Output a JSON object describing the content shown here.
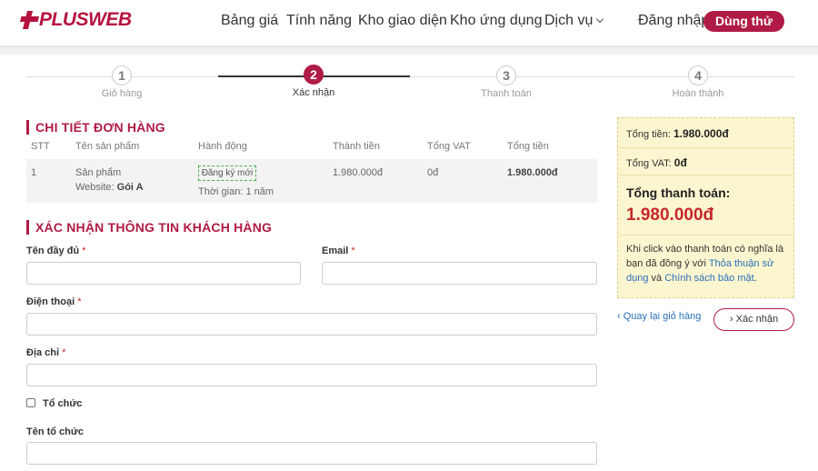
{
  "brand": {
    "logo_plus": "PLUS",
    "logo_web": "WEB",
    "color": "#b01b45"
  },
  "nav": {
    "pricing": "Bảng giá",
    "features": "Tính năng",
    "themes": "Kho giao diện",
    "apps": "Kho ứng dụng",
    "services": "Dịch vụ",
    "login": "Đăng nhập",
    "trial": "Dùng thử"
  },
  "steps": [
    {
      "num": "1",
      "label": "Giỏ hàng"
    },
    {
      "num": "2",
      "label": "Xác nhận"
    },
    {
      "num": "3",
      "label": "Thanh toán"
    },
    {
      "num": "4",
      "label": "Hoàn thành"
    }
  ],
  "order": {
    "title": "CHI TIẾT ĐƠN HÀNG",
    "headers": {
      "stt": "STT",
      "product": "Tên sản phẩm",
      "action": "Hành động",
      "amount": "Thành tiền",
      "vat": "Tổng VAT",
      "total": "Tổng tiền"
    },
    "row": {
      "stt": "1",
      "product": "Sản phẩm",
      "website_label": "Website: ",
      "website_value": "Gói A",
      "badge": "Đăng ký mới",
      "duration": "Thời gian: 1 năm",
      "amount": "1.980.000đ",
      "vat": "0đ",
      "total": "1.980.000đ"
    }
  },
  "customer": {
    "title": "XÁC NHẬN THÔNG TIN KHÁCH HÀNG",
    "fullname_label": "Tên đầy đủ",
    "email_label": "Email",
    "phone_label": "Điện thoại",
    "address_label": "Địa chỉ",
    "required_mark": "*",
    "org_checkbox_label": "Tổ chức",
    "org_name_label": "Tên tổ chức"
  },
  "summary": {
    "subtotal_label": "Tổng tiền: ",
    "subtotal_value": "1.980.000đ",
    "vat_label": "Tổng VAT: ",
    "vat_value": "0đ",
    "total_label": "Tổng thanh toán:",
    "total_value": "1.980.000đ",
    "note_prefix": "Khi click vào thanh toán có nghĩa là bạn đã đồng ý với ",
    "terms_link": "Thỏa thuận sử dụng",
    "note_and": " và ",
    "privacy_link": "Chính sách bảo mật",
    "note_suffix": "."
  },
  "actions": {
    "back": "‹ Quay lại giỏ hàng",
    "confirm": "› Xác nhận"
  }
}
